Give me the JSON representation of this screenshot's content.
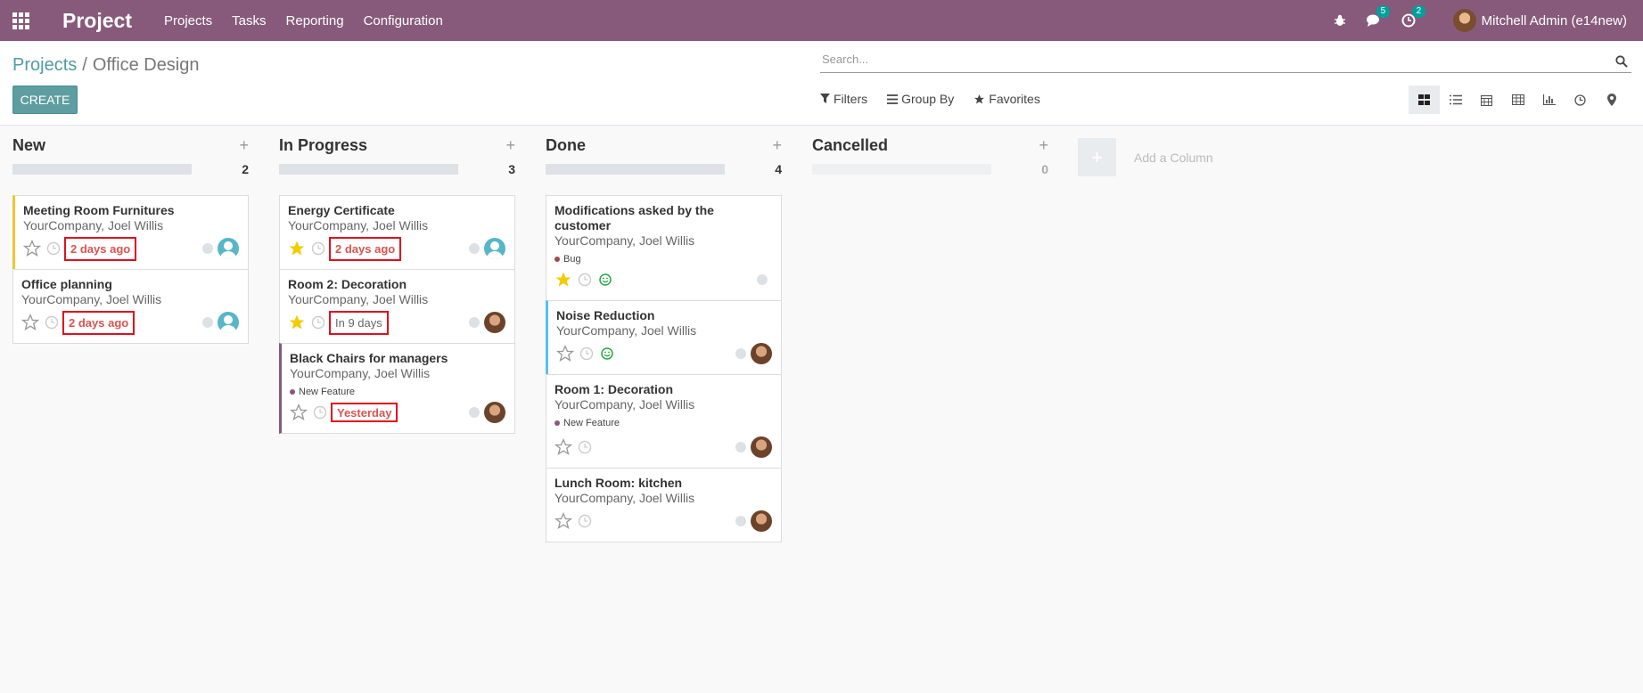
{
  "navbar": {
    "app_name": "Project",
    "menu": [
      "Projects",
      "Tasks",
      "Reporting",
      "Configuration"
    ],
    "messages_count": "5",
    "activities_count": "2",
    "user_name": "Mitchell Admin (e14new)"
  },
  "breadcrumb": {
    "parent": "Projects",
    "separator": "/",
    "current": "Office Design"
  },
  "create_label": "CREATE",
  "search": {
    "placeholder": "Search..."
  },
  "filters": {
    "filters_label": "Filters",
    "group_by_label": "Group By",
    "favorites_label": "Favorites"
  },
  "views": [
    "kanban-icon",
    "list-icon",
    "calendar-icon",
    "pivot-icon",
    "graph-icon",
    "activity-icon",
    "map-icon"
  ],
  "columns": [
    {
      "title": "New",
      "count": "2",
      "cards": [
        {
          "title": "Meeting Room Furnitures",
          "subtitle": "YourCompany, Joel Willis",
          "date": "2 days ago",
          "starred": false,
          "color": "yellow",
          "avatar": "placeholder"
        },
        {
          "title": "Office planning",
          "subtitle": "YourCompany, Joel Willis",
          "date": "2 days ago",
          "starred": false,
          "color": "none",
          "avatar": "placeholder"
        }
      ]
    },
    {
      "title": "In Progress",
      "count": "3",
      "cards": [
        {
          "title": "Energy Certificate",
          "subtitle": "YourCompany, Joel Willis",
          "date": "2 days ago",
          "starred": true,
          "color": "none",
          "avatar": "placeholder"
        },
        {
          "title": "Room 2: Decoration",
          "subtitle": "YourCompany, Joel Willis",
          "date": "In 9 days",
          "starred": true,
          "color": "none",
          "avatar": "photo"
        },
        {
          "title": "Black Chairs for managers",
          "subtitle": "YourCompany, Joel Willis",
          "tag": "New Feature",
          "date": "Yesterday",
          "starred": false,
          "color": "purple",
          "avatar": "photo"
        }
      ]
    },
    {
      "title": "Done",
      "count": "4",
      "cards": [
        {
          "title": "Modifications asked by the customer",
          "subtitle": "YourCompany, Joel Willis",
          "tag": "Bug",
          "starred": true,
          "color": "none"
        },
        {
          "title": "Noise Reduction",
          "subtitle": "YourCompany, Joel Willis",
          "starred": false,
          "color": "blue",
          "avatar": "photo"
        },
        {
          "title": "Room 1: Decoration",
          "subtitle": "YourCompany, Joel Willis",
          "tag": "New Feature",
          "starred": false,
          "color": "none",
          "avatar": "photo"
        },
        {
          "title": "Lunch Room: kitchen",
          "subtitle": "YourCompany, Joel Willis",
          "starred": false,
          "color": "none",
          "avatar": "photo"
        }
      ]
    },
    {
      "title": "Cancelled",
      "count": "0",
      "cards": []
    }
  ],
  "add_column_label": "Add a Column",
  "colors": {
    "navbar": "#875a7b",
    "accent": "#00a09d",
    "bug_tag": "#a24a4a",
    "feature_tag": "#875a7b",
    "deadline_red": "#d9534f"
  }
}
